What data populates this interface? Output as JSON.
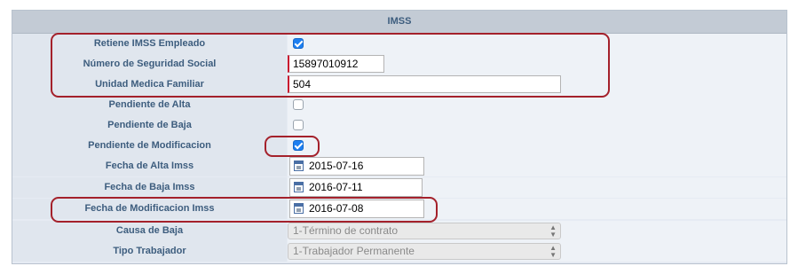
{
  "section": {
    "title": "IMSS"
  },
  "rows": {
    "retiene": {
      "label": "Retiene IMSS Empleado",
      "checked": true
    },
    "nss": {
      "label": "Número de Seguridad Social",
      "value": "15897010912"
    },
    "umf": {
      "label": "Unidad Medica Familiar",
      "value": "504"
    },
    "alta": {
      "label": "Pendiente de Alta",
      "checked": false
    },
    "baja": {
      "label": "Pendiente de Baja",
      "checked": false
    },
    "modif": {
      "label": "Pendiente de Modificacion",
      "checked": true
    },
    "fecha_alta": {
      "label": "Fecha de Alta Imss",
      "value": "2015-07-16"
    },
    "fecha_baja": {
      "label": "Fecha de Baja Imss",
      "value": "2016-07-11"
    },
    "fecha_modif": {
      "label": "Fecha de Modificacion Imss",
      "value": "2016-07-08"
    },
    "causa_baja": {
      "label": "Causa de Baja",
      "value": "1-Término de contrato"
    },
    "tipo_trab": {
      "label": "Tipo Trabajador",
      "value": "1-Trabajador Permanente"
    }
  },
  "icons": {
    "checkbox": "checkbox-icon",
    "calendar": "calendar-icon",
    "select_arrows": "select-arrows-icon"
  },
  "colors": {
    "label_text": "#3d5d7e",
    "highlight": "#a4212b",
    "checkbox_checked": "#1d7ff1"
  }
}
